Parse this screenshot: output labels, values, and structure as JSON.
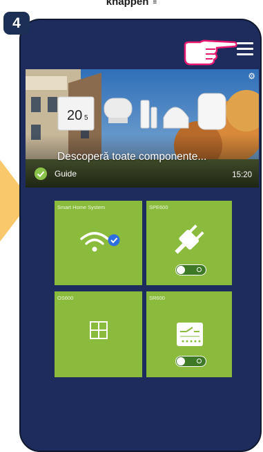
{
  "caption": {
    "text": "knappen",
    "small": "≡"
  },
  "step": {
    "number": "4"
  },
  "header": {
    "menu_icon": "hamburger-menu-icon",
    "pointer_icon": "pointing-hand-icon"
  },
  "banner": {
    "title": "Descoperă toate componente...",
    "tag": "Guide",
    "time": "15:20",
    "settings_icon": "gear-icon",
    "thermostat_reading": "20",
    "thermostat_decimal": "5"
  },
  "tiles": [
    {
      "label": "Smart Home System",
      "icon": "wifi-check-icon"
    },
    {
      "label": "SPE600",
      "icon": "plug-icon",
      "toggle": "off"
    },
    {
      "label": "OS600",
      "icon": "window-icon"
    },
    {
      "label": "SR600",
      "icon": "switch-module-icon",
      "toggle": "off"
    }
  ],
  "colors": {
    "phone_bg": "#1d2c5c",
    "tile_green": "#8bbb3c",
    "badge": "#1c2f55",
    "pointer": "#e6196e",
    "arrow": "#f9c86a"
  }
}
